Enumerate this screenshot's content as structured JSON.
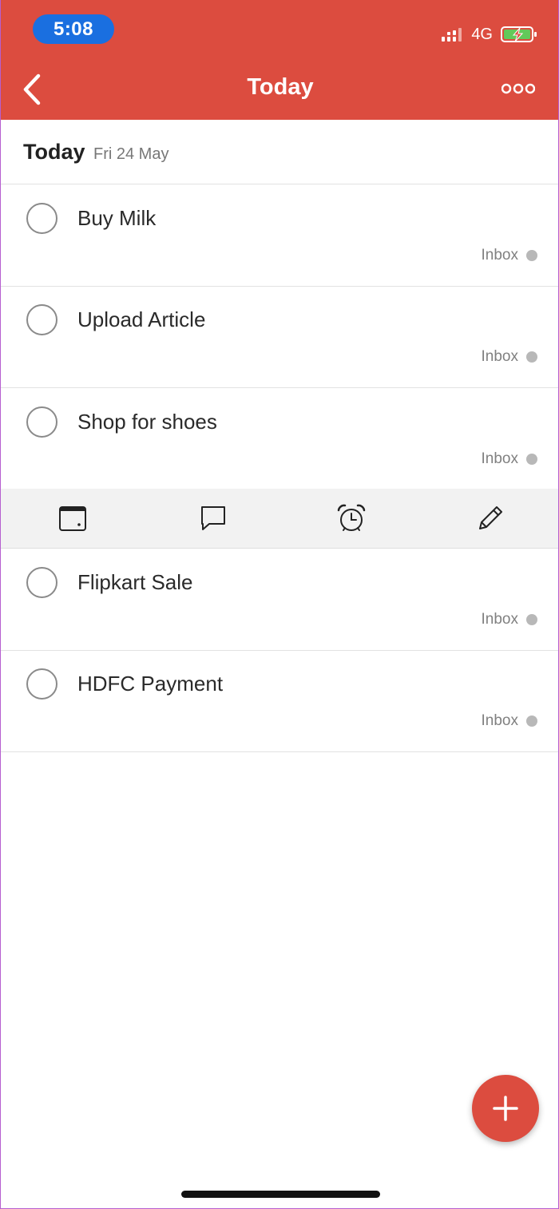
{
  "status_bar": {
    "time": "5:08",
    "network": "4G"
  },
  "nav": {
    "title": "Today"
  },
  "section": {
    "title": "Today",
    "date": "Fri 24 May"
  },
  "tasks": [
    {
      "title": "Buy Milk",
      "project": "Inbox"
    },
    {
      "title": "Upload Article",
      "project": "Inbox"
    },
    {
      "title": "Shop for shoes",
      "project": "Inbox"
    },
    {
      "title": "Flipkart Sale",
      "project": "Inbox"
    },
    {
      "title": "HDFC Payment",
      "project": "Inbox"
    }
  ],
  "action_bar": {
    "icons": [
      "calendar-icon",
      "comment-icon",
      "alarm-clock-icon",
      "pencil-icon"
    ]
  },
  "colors": {
    "brand": "#dc4c3f",
    "time_pill": "#1a6fe0",
    "project_dot": "#b8b8b8"
  }
}
